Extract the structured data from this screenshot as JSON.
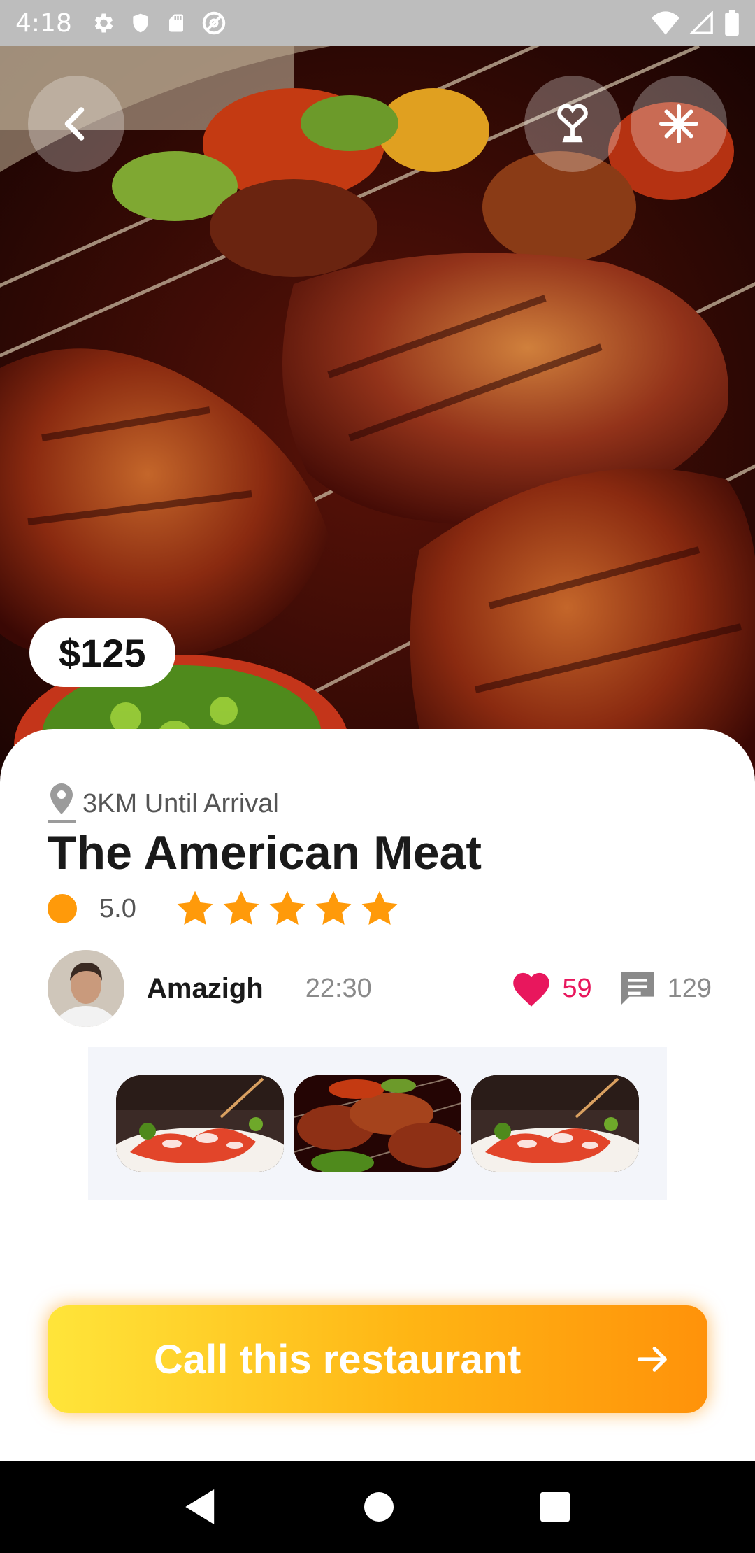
{
  "status_bar": {
    "time": "4:18",
    "icons": [
      "settings-icon",
      "shield-icon",
      "sd-card-icon",
      "at-sign-icon",
      "wifi-icon",
      "signal-icon",
      "battery-icon"
    ]
  },
  "hero": {
    "price": "$125",
    "buttons": [
      "back-icon",
      "heart-cup-icon",
      "snowflake-icon"
    ]
  },
  "details": {
    "distance": "3KM Until Arrival",
    "title": "The American Meat",
    "rating": "5.0",
    "stars": 5
  },
  "author": {
    "name": "Amazigh",
    "time": "22:30",
    "likes": "59",
    "comments": "129"
  },
  "gallery": {
    "thumbnails": [
      "lobster-dish",
      "grilled-meat",
      "lobster-dish"
    ]
  },
  "call_button": {
    "label": "Call this restaurant"
  },
  "colors": {
    "accent_orange": "#ff9a0a",
    "like_pink": "#e8175d",
    "button_gradient_start": "#ffe53a",
    "button_gradient_end": "#ff920a"
  }
}
